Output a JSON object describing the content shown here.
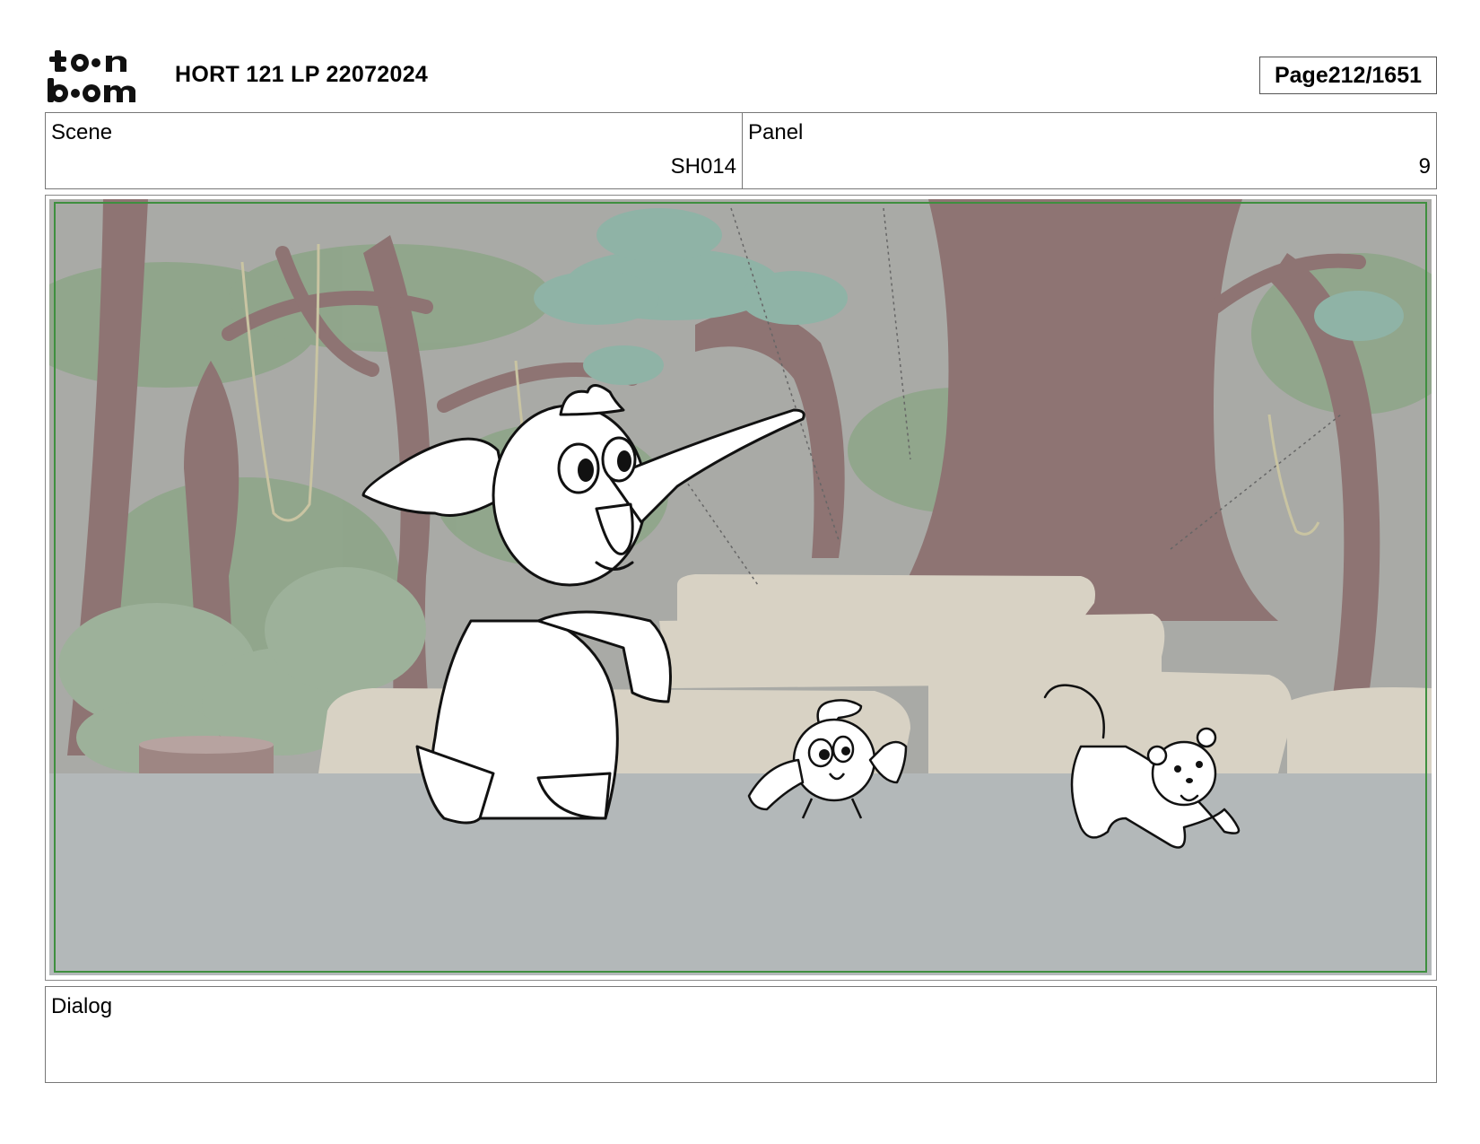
{
  "header": {
    "logo_text": "toon boom",
    "title": "HORT 121 LP 22072024",
    "page_label": "Page",
    "page_number": "212/1651"
  },
  "scene": {
    "label": "Scene",
    "value": "SH014"
  },
  "panel": {
    "label": "Panel",
    "value": "9"
  },
  "dialog": {
    "label": "Dialog",
    "text": ""
  },
  "colors": {
    "frame_border": "#3f8f3f",
    "sky": "#a9aaa6",
    "foliage": "#8fa58a",
    "trunk": "#8e7473",
    "cloud_teal": "#8fb3a6",
    "rock": "#d8d2c4",
    "ground": "#b3b8b9"
  }
}
